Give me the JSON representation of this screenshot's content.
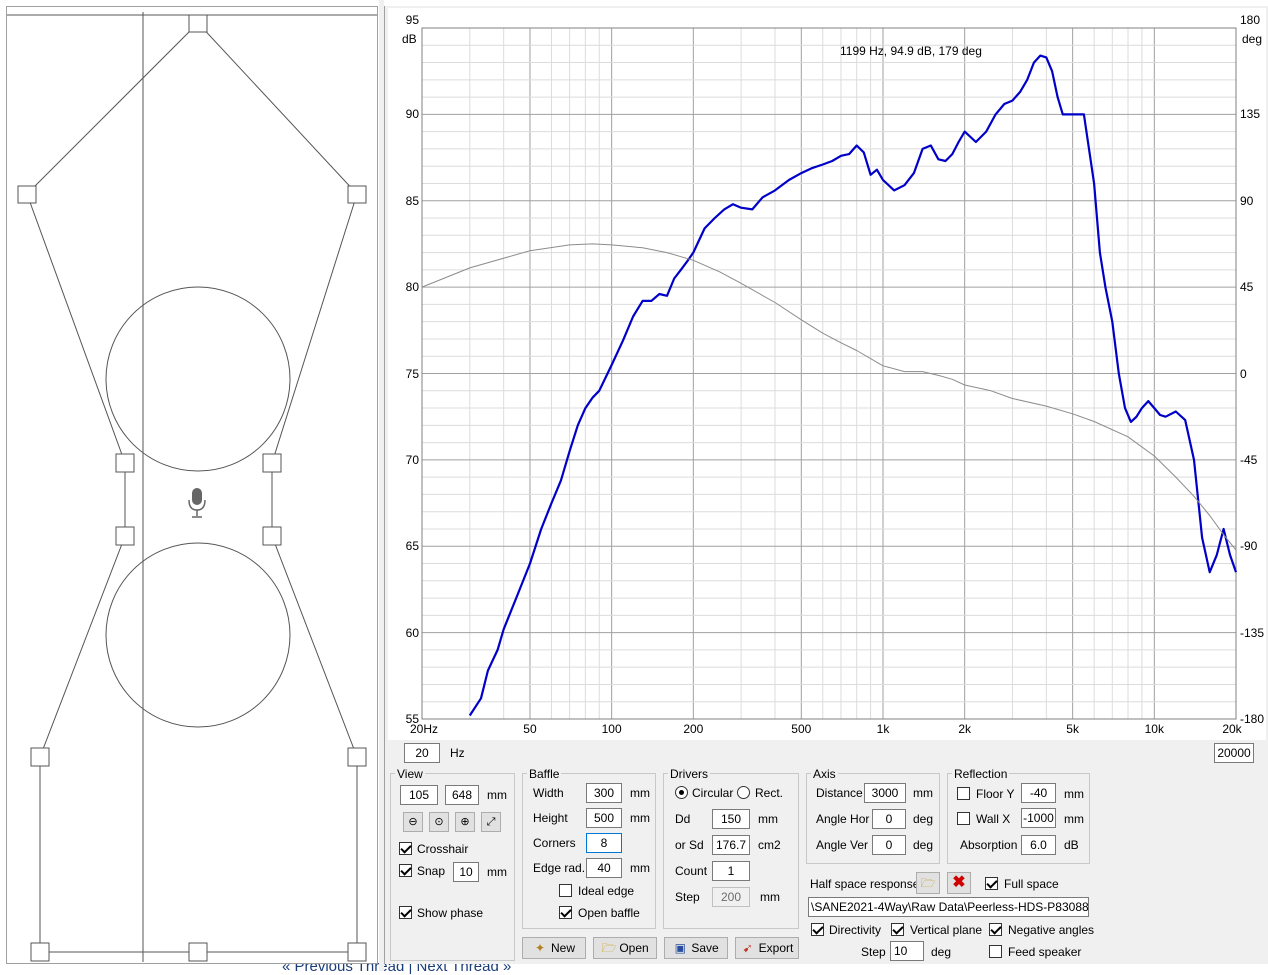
{
  "graph": {
    "readout": "1199 Hz, 94.9 dB, 179 deg",
    "left_unit": "dB",
    "right_unit": "deg",
    "y_left_ticks": [
      "95",
      "90",
      "85",
      "80",
      "75",
      "70",
      "65",
      "60",
      "55"
    ],
    "y_right_ticks": [
      "180",
      "135",
      "90",
      "45",
      "0",
      "-45",
      "-90",
      "-135",
      "-180"
    ],
    "x_ticks": [
      "20Hz",
      "50",
      "100",
      "200",
      "500",
      "1k",
      "2k",
      "5k",
      "10k",
      "20k"
    ],
    "colors": {
      "magnitude": "#0000c8",
      "phase": "#8c8c8c",
      "grid_major": "#a0a0a0",
      "grid_minor": "#dcdcdc"
    }
  },
  "chart_data": {
    "type": "line",
    "xlabel": "",
    "ylabel": "",
    "x_scale": "log",
    "xlim": [
      20,
      20000
    ],
    "ylim_left": [
      55,
      95
    ],
    "ylim_right": [
      -180,
      180
    ],
    "grid": true,
    "series": [
      {
        "axis": "left",
        "x": [
          30,
          33,
          35,
          38,
          40,
          45,
          50,
          55,
          60,
          65,
          70,
          75,
          80,
          85,
          90,
          100,
          110,
          120,
          130,
          140,
          150,
          160,
          170,
          180,
          190,
          200,
          220,
          240,
          260,
          280,
          300,
          330,
          360,
          400,
          450,
          500,
          550,
          600,
          650,
          700,
          750,
          780,
          800,
          850,
          900,
          950,
          1000,
          1100,
          1200,
          1300,
          1400,
          1500,
          1600,
          1700,
          1800,
          1900,
          2000,
          2200,
          2400,
          2600,
          2800,
          3000,
          3200,
          3400,
          3600,
          3800,
          4000,
          4200,
          4400,
          4600,
          4800,
          5000,
          5500,
          6000,
          6300,
          6600,
          7000,
          7400,
          7800,
          8200,
          8600,
          9000,
          9500,
          10000,
          10500,
          11000,
          12000,
          13000,
          14000,
          15000,
          16000,
          17000,
          18000,
          19000,
          20000
        ],
        "y": [
          55.2,
          56.2,
          57.8,
          59,
          60.2,
          62.2,
          64,
          66,
          67.5,
          68.8,
          70.5,
          72,
          73,
          73.6,
          74,
          75.5,
          76.9,
          78.3,
          79.2,
          79.2,
          79.6,
          79.5,
          80.5,
          81,
          81.5,
          82,
          83.4,
          84,
          84.5,
          84.8,
          84.6,
          84.5,
          85.2,
          85.6,
          86.2,
          86.6,
          86.9,
          87.1,
          87.3,
          87.6,
          87.7,
          88,
          88.2,
          87.8,
          86.5,
          86.8,
          86.2,
          85.6,
          85.9,
          86.6,
          88,
          88.2,
          87.4,
          87.3,
          87.7,
          88.4,
          89,
          88.4,
          89,
          90,
          90.6,
          90.8,
          91.3,
          92,
          93,
          93.4,
          93.3,
          92.5,
          91,
          90,
          90,
          90,
          90,
          86,
          82,
          80,
          78,
          75,
          73,
          72.2,
          72.5,
          73,
          73.4,
          73,
          72.6,
          72.5,
          72.8,
          72.3,
          70,
          65.5,
          63.5,
          64.5,
          66,
          64.5,
          63.5
        ]
      },
      {
        "axis": "right",
        "x": [
          20,
          30,
          50,
          70,
          85,
          100,
          130,
          160,
          200,
          250,
          300,
          400,
          500,
          600,
          700,
          800,
          1000,
          1200,
          1400,
          1600,
          1800,
          2000,
          2500,
          3000,
          4000,
          5000,
          6000,
          8000,
          10000,
          12000,
          14000,
          16000,
          18000,
          20000
        ],
        "y": [
          45,
          55,
          64,
          67,
          67.5,
          67,
          65.5,
          63,
          59,
          53,
          47,
          37,
          28,
          21,
          16,
          12,
          4,
          1,
          1,
          -1,
          -3,
          -6,
          -9,
          -13,
          -17,
          -21,
          -25,
          -33,
          -43,
          -54,
          -64,
          -74,
          -84,
          -92
        ]
      }
    ]
  },
  "freq_min": "20",
  "freq_max": "20000",
  "hz_unit": "Hz",
  "view": {
    "title": "View",
    "x": "105",
    "y": "648",
    "unit": "mm",
    "crosshair_label": "Crosshair",
    "crosshair_checked": true,
    "snap_label": "Snap",
    "snap_checked": true,
    "snap_value": "10",
    "snap_unit": "mm",
    "show_phase_label": "Show phase",
    "show_phase_checked": true
  },
  "baffle": {
    "title": "Baffle",
    "width_label": "Width",
    "width": "300",
    "height_label": "Height",
    "height": "500",
    "corners_label": "Corners",
    "corners": "8",
    "edge_label": "Edge rad.",
    "edge": "40",
    "unit": "mm",
    "ideal_edge_label": "Ideal edge",
    "ideal_edge_checked": false,
    "open_baffle_label": "Open baffle",
    "open_baffle_checked": true
  },
  "drivers": {
    "title": "Drivers",
    "circular_label": "Circular",
    "rect_label": "Rect.",
    "dd_label": "Dd",
    "dd": "150",
    "dd_unit": "mm",
    "sd_label": "or Sd",
    "sd": "176.7",
    "sd_unit": "cm2",
    "count_label": "Count",
    "count": "1",
    "step_label": "Step",
    "step": "200",
    "step_unit": "mm"
  },
  "axis": {
    "title": "Axis",
    "distance_label": "Distance",
    "distance": "3000",
    "distance_unit": "mm",
    "hor_label": "Angle Hor",
    "hor": "0",
    "hor_unit": "deg",
    "ver_label": "Angle Ver",
    "ver": "0",
    "ver_unit": "deg"
  },
  "reflection": {
    "title": "Reflection",
    "floor_label": "Floor Y",
    "floor": "-40",
    "floor_unit": "mm",
    "floor_checked": false,
    "wall_label": "Wall  X",
    "wall": "-1000",
    "wall_unit": "mm",
    "wall_checked": false,
    "absorption_label": "Absorption",
    "absorption": "6.0",
    "absorption_unit": "dB"
  },
  "halfspace": {
    "label": "Half space response",
    "full_space_label": "Full space",
    "full_space_checked": true,
    "path": "\\SANE2021-4Way\\Raw Data\\Peerless-HDS-P830883.frd",
    "directivity_label": "Directivity",
    "directivity_checked": true,
    "vertical_label": "Vertical plane",
    "vertical_checked": true,
    "negative_label": "Negative angles",
    "negative_checked": true,
    "step_label": "Step",
    "step": "10",
    "step_unit": "deg",
    "feed_label": "Feed speaker",
    "feed_checked": false
  },
  "buttons": {
    "new": "New",
    "open": "Open",
    "save": "Save",
    "export": "Export"
  },
  "background_text": "« Previous Thread | Next Thread »"
}
